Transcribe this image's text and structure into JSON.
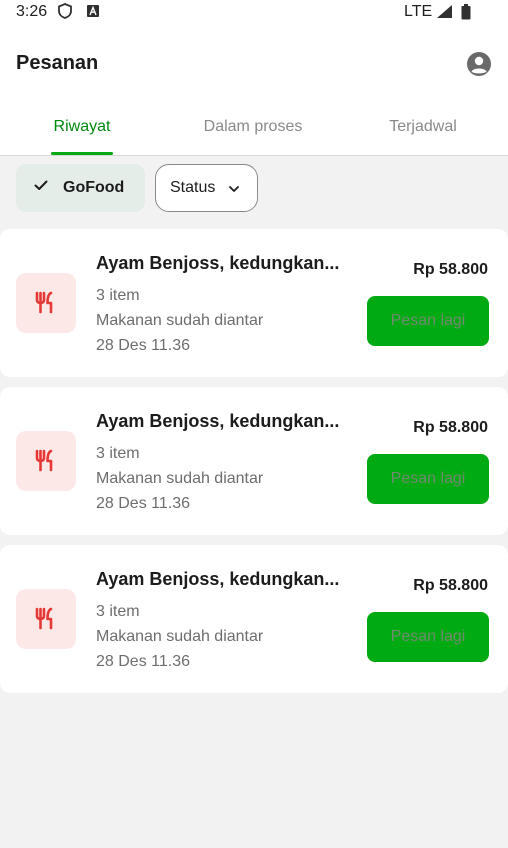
{
  "status_bar": {
    "time": "3:26",
    "network": "LTE"
  },
  "header": {
    "title": "Pesanan"
  },
  "tabs": [
    {
      "label": "Riwayat",
      "active": true
    },
    {
      "label": "Dalam proses",
      "active": false
    },
    {
      "label": "Terjadwal",
      "active": false
    }
  ],
  "filters": {
    "service": {
      "label": "GoFood",
      "selected": true
    },
    "status": {
      "label": "Status"
    }
  },
  "orders": [
    {
      "merchant": "Ayam Benjoss, kedungkan...",
      "items": "3 item",
      "status": "Makanan sudah diantar",
      "date": "28 Des 11.36",
      "price": "Rp 58.800",
      "reorder_label": "Pesan lagi"
    },
    {
      "merchant": "Ayam Benjoss, kedungkan...",
      "items": "3 item",
      "status": "Makanan sudah diantar",
      "date": "28 Des 11.36",
      "price": "Rp 58.800",
      "reorder_label": "Pesan lagi"
    },
    {
      "merchant": "Ayam Benjoss, kedungkan...",
      "items": "3 item",
      "status": "Makanan sudah diantar",
      "date": "28 Des 11.36",
      "price": "Rp 58.800",
      "reorder_label": "Pesan lagi"
    }
  ],
  "colors": {
    "accent": "#00aa13",
    "active_tab": "#00880d",
    "chip_selected_bg": "#e5ede8",
    "food_icon_bg": "#fde8e8",
    "food_icon": "#e53935"
  }
}
